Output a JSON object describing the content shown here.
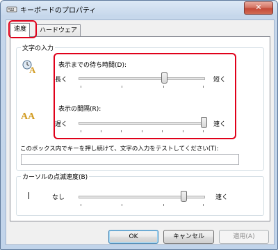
{
  "window": {
    "title": "キーボードのプロパティ",
    "close_label": "✕"
  },
  "tabs": [
    {
      "label": "速度",
      "selected": true
    },
    {
      "label": "ハードウェア",
      "selected": false
    }
  ],
  "char_input_group": {
    "title": "文字の入力",
    "repeat_delay": {
      "label": "表示までの待ち時間(D):",
      "left_label": "長く",
      "right_label": "短く",
      "value_fraction": 0.67
    },
    "repeat_rate": {
      "label": "表示の間隔(R):",
      "left_label": "遅く",
      "right_label": "速く",
      "value_fraction": 1.0
    },
    "test_label": "このボックス内でキーを押し続けて、文字の入力をテストしてください(T):",
    "test_value": ""
  },
  "cursor_group": {
    "title": "カーソルの点滅速度(B)",
    "left_label": "なし",
    "right_label": "速く",
    "value_fraction": 0.83
  },
  "buttons": {
    "ok": "OK",
    "cancel": "キャンセル",
    "apply": "適用(A)"
  },
  "colors": {
    "highlight": "#e0001a",
    "title_gradient": "#c6d7eb",
    "close_button": "#c44a38"
  }
}
